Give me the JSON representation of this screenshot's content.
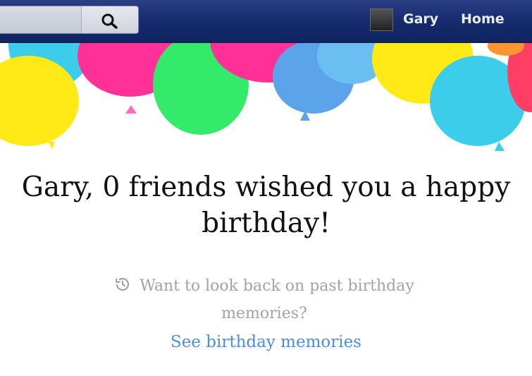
{
  "header": {
    "search_icon": "search-icon",
    "user_name": "Gary",
    "home_label": "Home"
  },
  "banner": {
    "decoration": "balloons",
    "colors": [
      "#ffe800",
      "#28c8e8",
      "#ff1a8c",
      "#1ee85a",
      "#4a9be8",
      "#ff2a55"
    ]
  },
  "main": {
    "headline": "Gary, 0 friends wished you a happy birthday!",
    "memories_prompt": "Want to look back on past birthday memories?",
    "memories_icon": "history-icon",
    "see_memories_link": "See birthday memories",
    "link_color": "#4a8ee0"
  }
}
